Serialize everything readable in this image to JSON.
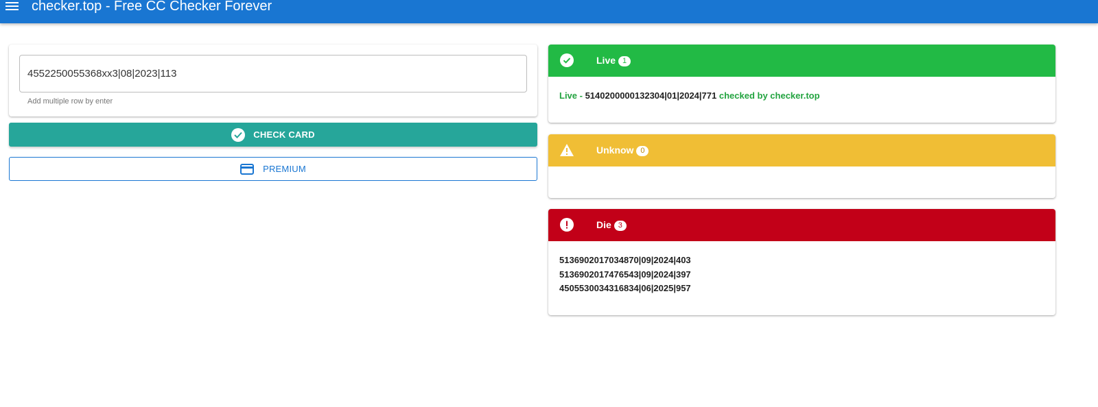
{
  "app": {
    "title": "checker.top - Free CC Checker Forever",
    "primary_color": "#1976d2"
  },
  "input": {
    "value": "4552250055368xx3|08|2023|113",
    "hint": "Add multiple row by enter"
  },
  "buttons": {
    "check_label": "CHECK CARD",
    "check_color": "#26a69a",
    "premium_label": "PREMIUM"
  },
  "results": {
    "live": {
      "title": "Live",
      "count": "1",
      "color": "#22ba45",
      "icon": "check-circle-icon",
      "entries": [
        {
          "prefix": "Live - ",
          "card": "5140200000132304|01|2024|771",
          "suffix": " checked by checker.top"
        }
      ]
    },
    "unknow": {
      "title": "Unknow",
      "count": "0",
      "color": "#f0be35",
      "icon": "warning-triangle-icon",
      "entries": []
    },
    "die": {
      "title": "Die",
      "count": "3",
      "color": "#c20018",
      "icon": "exclamation-circle-icon",
      "entries": [
        "5136902017034870|09|2024|403",
        "5136902017476543|09|2024|397",
        "4505530034316834|06|2025|957"
      ]
    }
  }
}
